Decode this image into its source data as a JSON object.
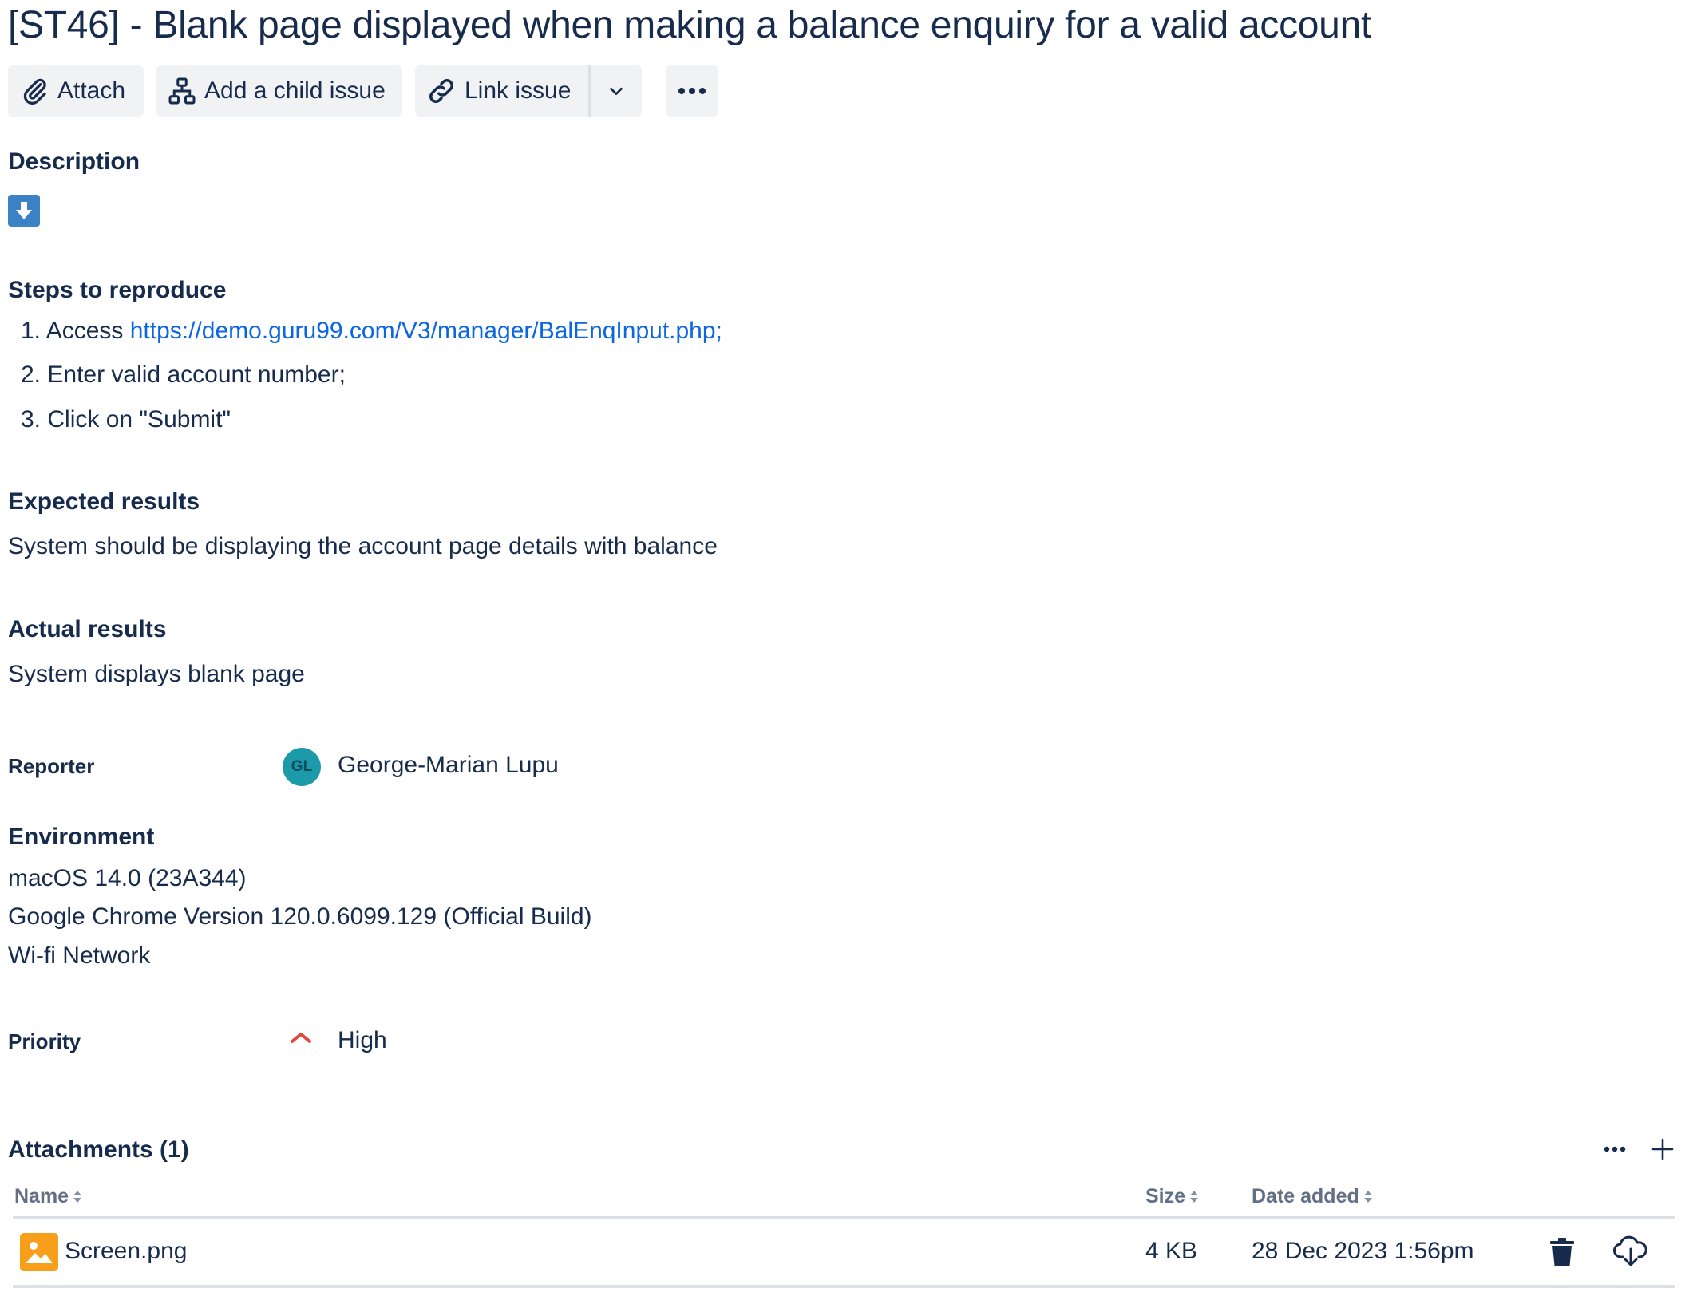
{
  "issue": {
    "title": "[ST46] - Blank page displayed when making a balance enquiry for a valid account"
  },
  "toolbar": {
    "attach_label": "Attach",
    "child_issue_label": "Add a child issue",
    "link_issue_label": "Link issue",
    "icons": [
      "paperclip-icon",
      "hierarchy-icon",
      "link-icon",
      "chevron-down-icon",
      "more-icon"
    ]
  },
  "description": {
    "heading": "Description",
    "steps_heading": "Steps to reproduce",
    "steps": [
      {
        "number": "1.",
        "prefix": "Access ",
        "link": "https://demo.guru99.com/V3/manager/BalEnqInput.php;"
      },
      {
        "number": "2.",
        "text": "Enter valid account number;"
      },
      {
        "number": "3.",
        "text": "Click on \"Submit\""
      }
    ],
    "expected_heading": "Expected results",
    "expected_text": "System should be displaying the account page details with balance",
    "actual_heading": "Actual results",
    "actual_text": "System displays blank page"
  },
  "reporter": {
    "label": "Reporter",
    "initials": "GL",
    "name": "George-Marian Lupu"
  },
  "environment": {
    "heading": "Environment",
    "lines": [
      "macOS 14.0 (23A344)",
      "Google Chrome Version 120.0.6099.129 (Official Build)",
      "Wi-fi Network"
    ]
  },
  "priority": {
    "label": "Priority",
    "value": "High"
  },
  "attachments": {
    "heading": "Attachments (1)",
    "columns": {
      "name": "Name",
      "size": "Size",
      "date": "Date added"
    },
    "rows": [
      {
        "name": "Screen.png",
        "size": "4 KB",
        "date": "28 Dec 2023 1:56pm"
      }
    ]
  },
  "colors": {
    "text": "#172b4d",
    "link": "#0c66e4",
    "button_bg": "#f1f2f4",
    "avatar": "#1d9aaa",
    "priority_high": "#e2483d",
    "image_icon": "#f79e1b",
    "description_icon": "#3b82c4"
  }
}
